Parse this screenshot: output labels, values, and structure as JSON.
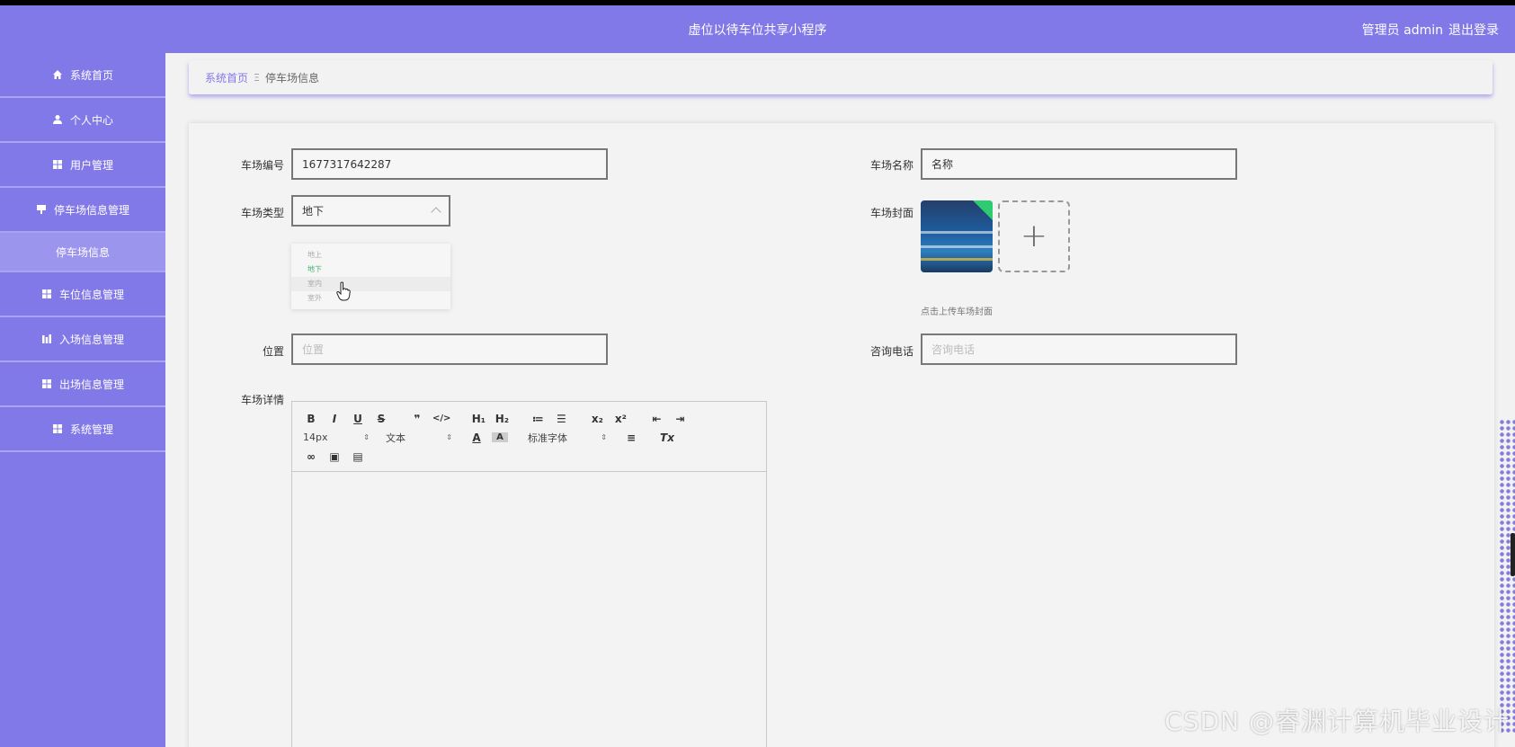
{
  "header": {
    "app_title": "虚位以待车位共享小程序",
    "user_label": "管理员 admin",
    "logout_label": "退出登录"
  },
  "sidebar": {
    "items": [
      {
        "label": "系统首页",
        "icon": "home-icon"
      },
      {
        "label": "个人中心",
        "icon": "user-icon"
      },
      {
        "label": "用户管理",
        "icon": "grid-icon"
      },
      {
        "label": "停车场信息管理",
        "icon": "sign-icon"
      },
      {
        "label": "停车场信息",
        "icon": "",
        "sub": true
      },
      {
        "label": "车位信息管理",
        "icon": "grid-icon"
      },
      {
        "label": "入场信息管理",
        "icon": "bar-chart-icon"
      },
      {
        "label": "出场信息管理",
        "icon": "grid-icon"
      },
      {
        "label": "系统管理",
        "icon": "grid-icon"
      }
    ]
  },
  "breadcrumb": {
    "home": "系统首页",
    "separator": "Ξ",
    "current": "停车场信息"
  },
  "form": {
    "lot_no_label": "车场编号",
    "lot_no_value": "1677317642287",
    "lot_name_label": "车场名称",
    "lot_name_value": "名称",
    "lot_type_label": "车场类型",
    "lot_type_value": "地下",
    "lot_type_options": [
      "地上",
      "地下",
      "室内",
      "室外"
    ],
    "cover_label": "车场封面",
    "cover_upload_plus": "+",
    "cover_tip": "点击上传车场封面",
    "location_label": "位置",
    "location_placeholder": "位置",
    "phone_label": "咨询电话",
    "phone_placeholder": "咨询电话",
    "detail_label": "车场详情"
  },
  "editor": {
    "row1": [
      "B",
      "I",
      "U",
      "S",
      "❞",
      "</>",
      "H₁",
      "H₂",
      "≔",
      "☰",
      "x₂",
      "x²",
      "⇤",
      "⇥"
    ],
    "font_size": "14px",
    "text_type": "文本",
    "font_family": "标准字体",
    "clear_format": "Tx"
  },
  "watermark": "CSDN @睿渊计算机毕业设计",
  "colors": {
    "brand": "#8279e9",
    "selected_option": "#3cb371"
  }
}
